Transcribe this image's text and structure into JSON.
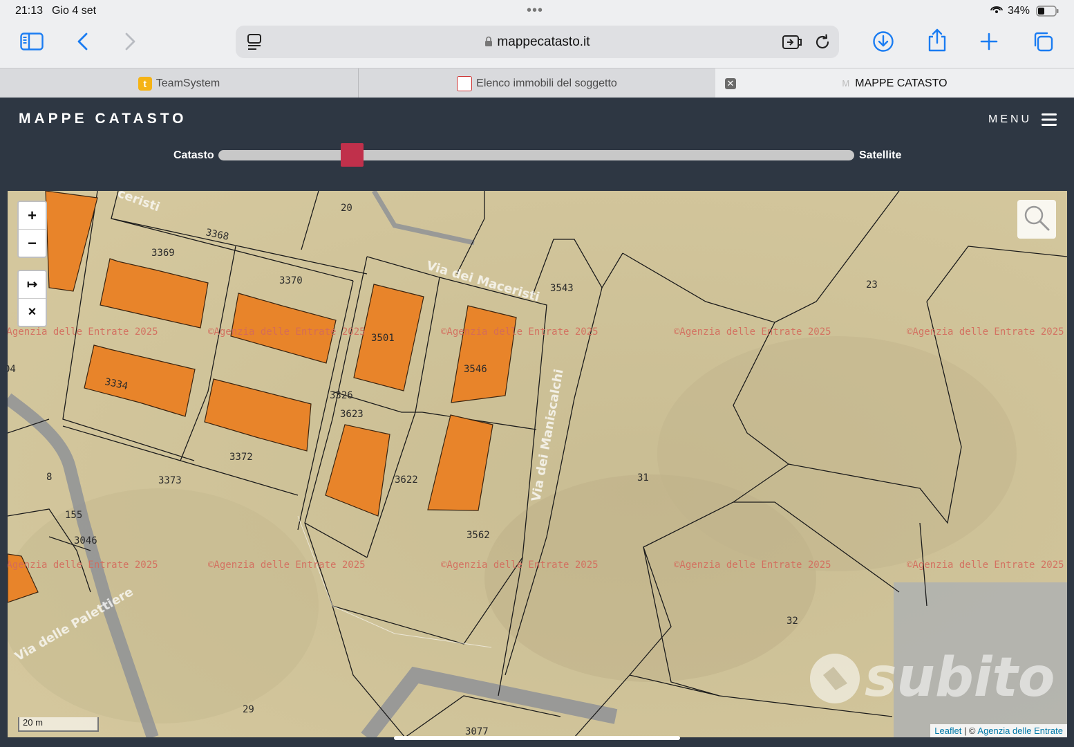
{
  "status_bar": {
    "time": "21:13",
    "date": "Gio 4 set",
    "battery": "34%"
  },
  "browser": {
    "url": "mappecatasto.it",
    "tabs": [
      {
        "label": "TeamSystem",
        "favicon": "teamsystem-favicon"
      },
      {
        "label": "Elenco immobili del soggetto",
        "favicon": "agenzia-favicon"
      },
      {
        "label": "MAPPE CATASTO",
        "favicon": "m-favicon",
        "active": true
      }
    ]
  },
  "site": {
    "title": "MAPPE CATASTO",
    "menu_label": "MENU",
    "slider": {
      "left_label": "Catasto",
      "right_label": "Satellite",
      "value": 0.2
    }
  },
  "map": {
    "watermark": "©Agenzia delle Entrate 2025",
    "parcels": [
      "20",
      "3368",
      "3369",
      "3370",
      "3543",
      "23",
      "3501",
      "3546",
      "3334",
      "3326",
      "3623",
      "3622",
      "3372",
      "3373",
      "31",
      "3562",
      "155",
      "3046",
      "32",
      "29",
      "3077",
      "04",
      "8"
    ],
    "streets": [
      "Via dei Maceristi",
      "Via dei Maniscalchi",
      "Via delle Palettiere"
    ],
    "zoom_in": "+",
    "zoom_out": "−",
    "measure": "↦",
    "clear": "×",
    "scale": "20 m",
    "attribution": {
      "leaflet": "Leaflet",
      "sep": " | © ",
      "agenzia": "Agenzia delle Entrate"
    }
  },
  "overlay_logo": "subito"
}
